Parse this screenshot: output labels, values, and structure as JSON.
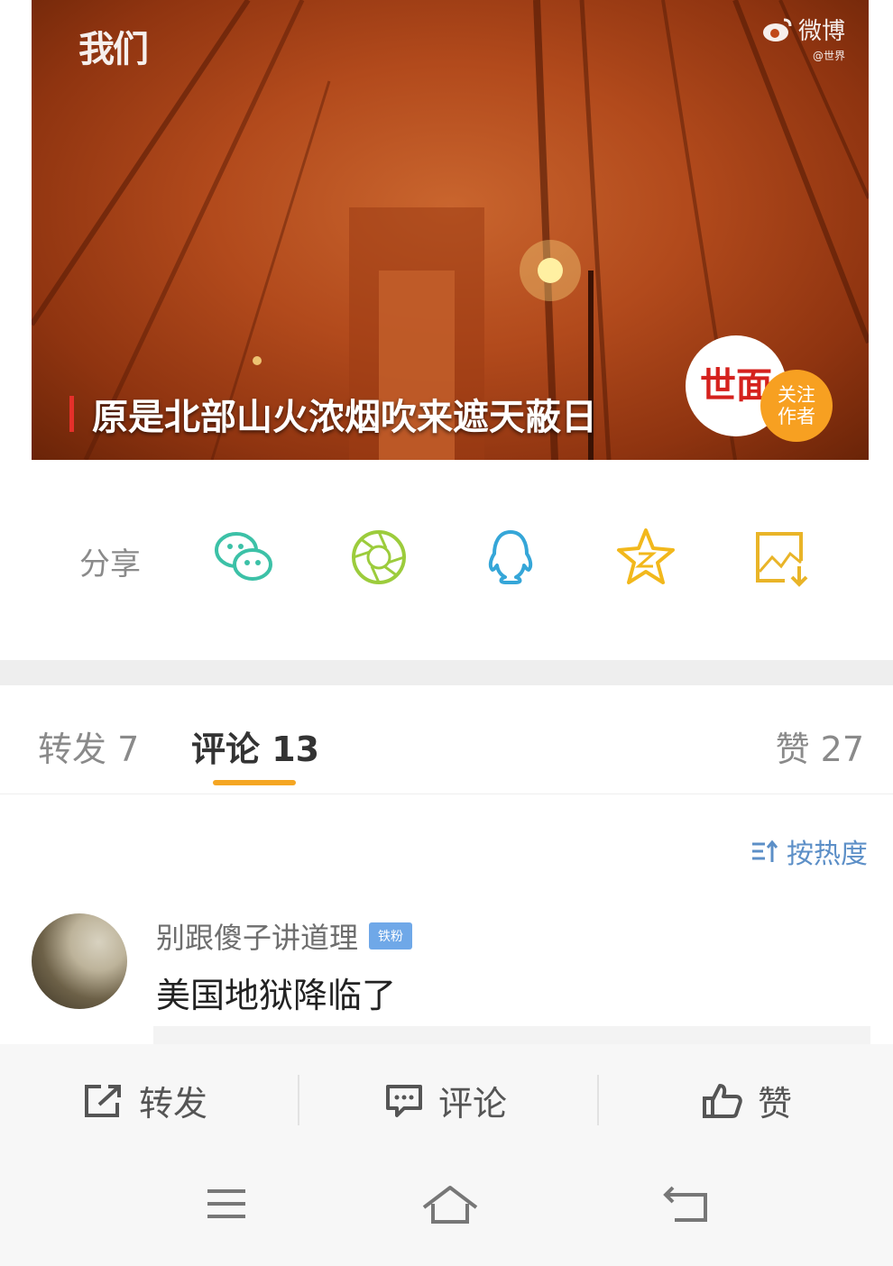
{
  "video": {
    "watermark_left": "我们",
    "watermark_right": "微博",
    "watermark_sub": "@世界",
    "caption": "原是北部山火浓烟吹来遮天蔽日",
    "logo_text": "世面",
    "follow_line1": "关注",
    "follow_line2": "作者"
  },
  "share": {
    "label": "分享",
    "icons": [
      "wechat-icon",
      "moments-icon",
      "qq-icon",
      "qzone-icon",
      "save-image-icon"
    ]
  },
  "tabs": {
    "repost": "转发 7",
    "comments": "评论 13",
    "likes": "赞 27"
  },
  "sort": {
    "label": "按热度"
  },
  "comment": {
    "username": "别跟傻子讲道理",
    "badge": "铁粉",
    "text": "美国地狱降临了"
  },
  "actions": {
    "repost": "转发",
    "comment": "评论",
    "like": "赞"
  },
  "colors": {
    "accent": "#f5a623",
    "link": "#5c8fc7",
    "wechat": "#3cc1a7",
    "moments": "#9ccc3c",
    "qq": "#35a6d8",
    "qzone": "#f2b81c",
    "save": "#e9b428"
  }
}
